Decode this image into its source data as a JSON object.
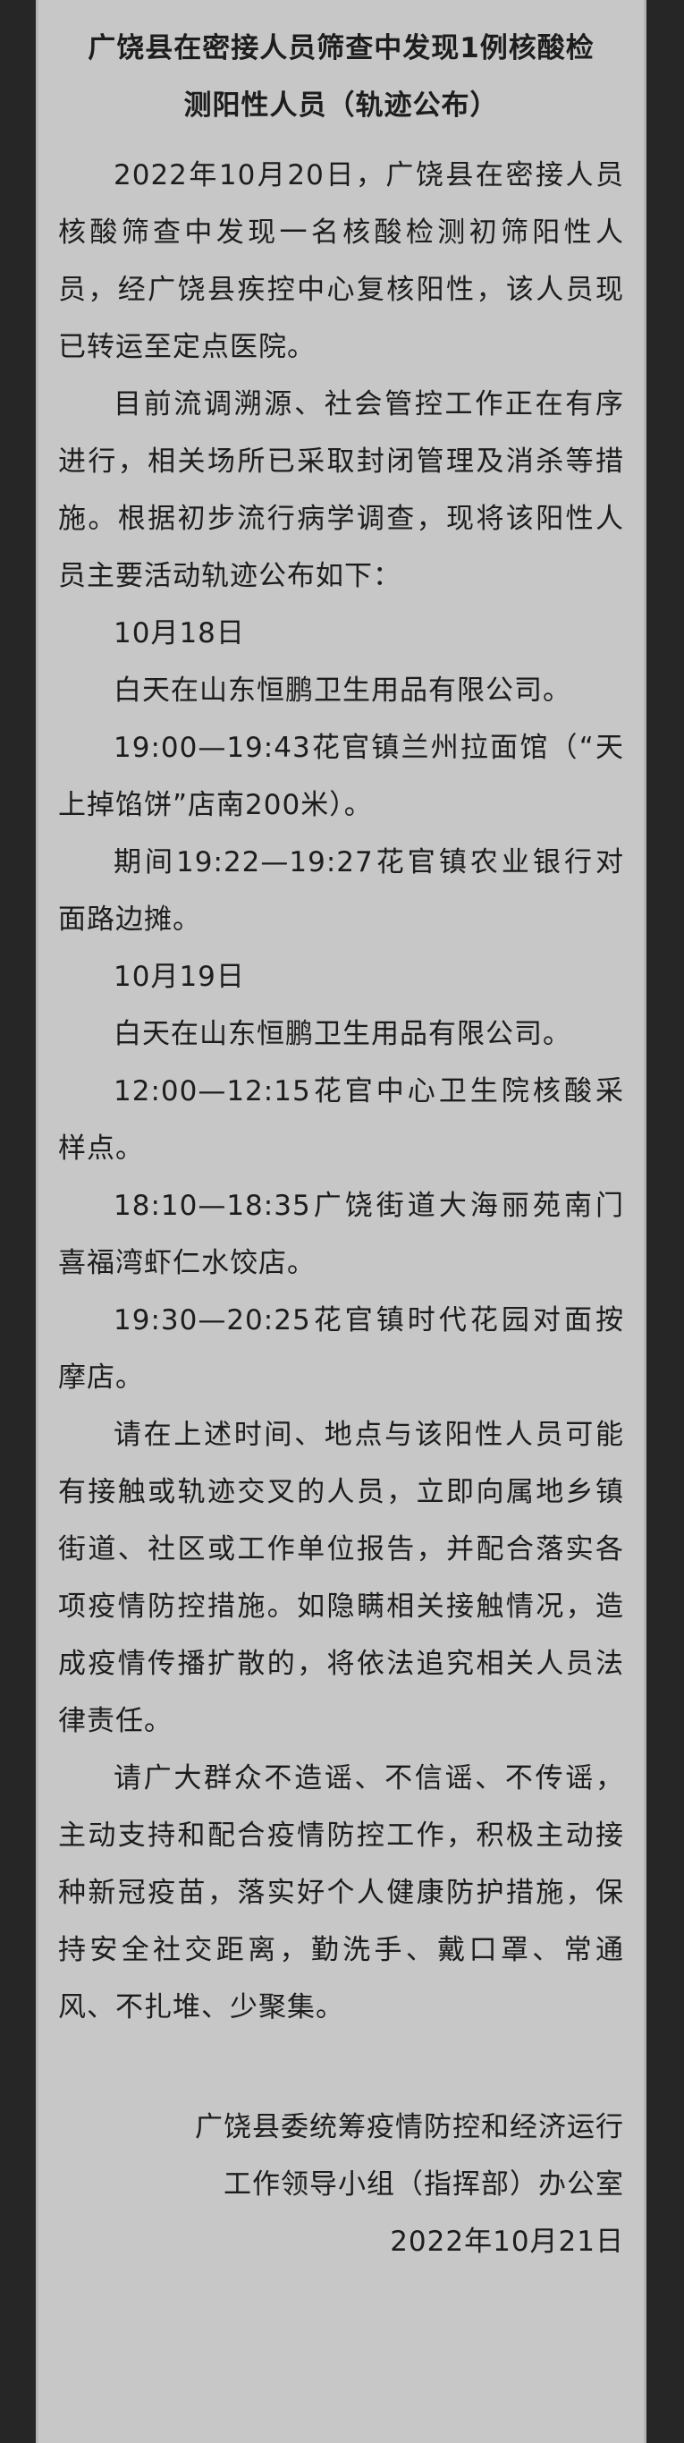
{
  "title": "广饶县在密接人员筛查中发现1例核酸检测阳性人员（轨迹公布）",
  "paragraphs": [
    "2022年10月20日，广饶县在密接人员核酸筛查中发现一名核酸检测初筛阳性人员，经广饶县疾控中心复核阳性，该人员现已转运至定点医院。",
    "目前流调溯源、社会管控工作正在有序进行，相关场所已采取封闭管理及消杀等措施。根据初步流行病学调查，现将该阳性人员主要活动轨迹公布如下：",
    "10月18日",
    "白天在山东恒鹏卫生用品有限公司。",
    "19:00—19:43花官镇兰州拉面馆（“天上掉馅饼”店南200米）。",
    "期间19:22—19:27花官镇农业银行对面路边摊。",
    "10月19日",
    "白天在山东恒鹏卫生用品有限公司。",
    "12:00—12:15花官中心卫生院核酸采样点。",
    "18:10—18:35广饶街道大海丽苑南门喜福湾虾仁水饺店。",
    "19:30—20:25花官镇时代花园对面按摩店。",
    "请在上述时间、地点与该阳性人员可能有接触或轨迹交叉的人员，立即向属地乡镇街道、社区或工作单位报告，并配合落实各项疫情防控措施。如隐瞒相关接触情况，造成疫情传播扩散的，将依法追究相关人员法律责任。",
    "请广大群众不造谣、不信谣、不传谣，主动支持和配合疫情防控工作，积极主动接种新冠疫苗，落实好个人健康防护措施，保持安全社交距离，勤洗手、戴口罩、常通风、不扎堆、少聚集。"
  ],
  "signature": {
    "line1": "广饶县委统筹疫情防控和经济运行",
    "line2": "工作领导小组（指挥部）办公室",
    "date": "2022年10月21日"
  }
}
